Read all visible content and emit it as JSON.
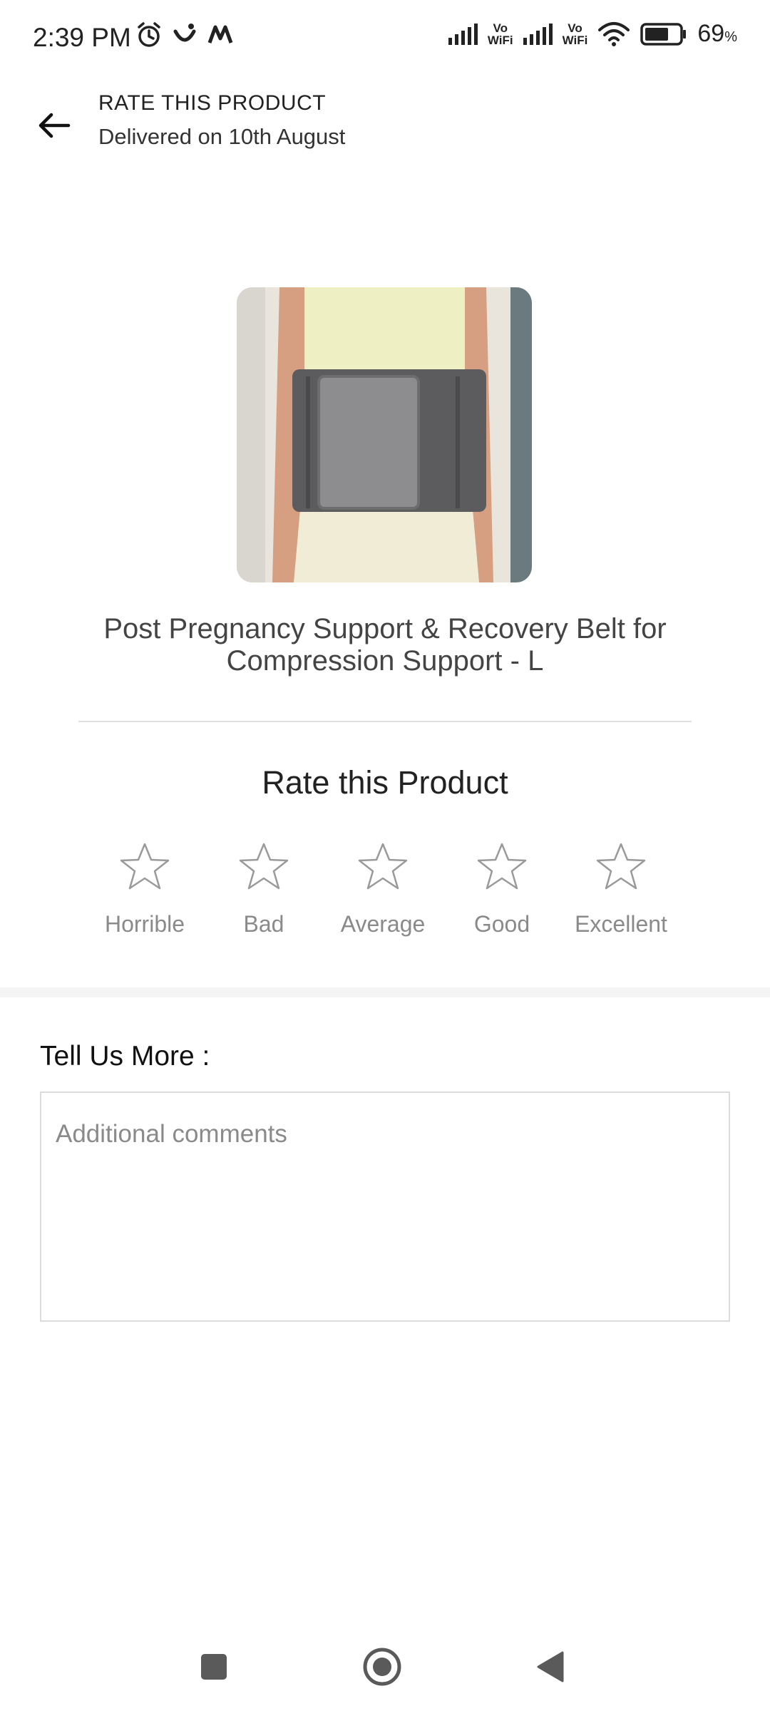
{
  "status_bar": {
    "time": "2:39 PM",
    "vowifi_label_1": "Vo\nWiFi",
    "vowifi_label_2": "Vo\nWiFi",
    "battery_percent": "69",
    "battery_unit": "%",
    "battery_level": 0.69,
    "icons": [
      "alarm-icon",
      "app-notification-icon",
      "m-notification-icon",
      "signal-icon",
      "wifi-icon",
      "battery-icon"
    ]
  },
  "header": {
    "title": "RATE THIS PRODUCT",
    "subtitle": "Delivered on 10th August",
    "back_icon": "arrow-left-icon"
  },
  "product": {
    "title": "Post Pregnancy Support & Recovery Belt for Compression Support - L"
  },
  "rating": {
    "heading": "Rate this Product",
    "options": [
      {
        "label": "Horrible"
      },
      {
        "label": "Bad"
      },
      {
        "label": "Average"
      },
      {
        "label": "Good"
      },
      {
        "label": "Excellent"
      }
    ],
    "selected": 0
  },
  "feedback": {
    "label": "Tell Us More :",
    "placeholder": "Additional comments",
    "value": ""
  },
  "nav_bar": {
    "icons": [
      "recents-square-icon",
      "home-circle-icon",
      "back-triangle-icon"
    ]
  },
  "colors": {
    "background": "#ffffff",
    "text_primary": "#222222",
    "text_muted": "#8a8a8a",
    "star_outline": "#9a9a9a",
    "divider": "#e0e0e0"
  }
}
